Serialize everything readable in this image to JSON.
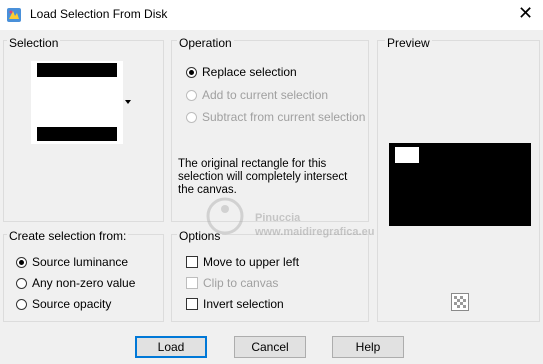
{
  "window": {
    "title": "Load Selection From Disk"
  },
  "selection": {
    "label": "Selection"
  },
  "operation": {
    "label": "Operation",
    "options": [
      {
        "label": "Replace selection",
        "checked": true,
        "enabled": true
      },
      {
        "label": "Add to current selection",
        "checked": false,
        "enabled": false
      },
      {
        "label": "Subtract from current selection",
        "checked": false,
        "enabled": false
      }
    ],
    "description": "The original rectangle for this selection will completely intersect the canvas."
  },
  "preview": {
    "label": "Preview"
  },
  "create_from": {
    "label": "Create selection from:",
    "options": [
      {
        "label": "Source luminance",
        "checked": true
      },
      {
        "label": "Any non-zero value",
        "checked": false
      },
      {
        "label": "Source opacity",
        "checked": false
      }
    ]
  },
  "options": {
    "label": "Options",
    "items": [
      {
        "label": "Move to upper left",
        "checked": false,
        "enabled": true
      },
      {
        "label": "Clip to canvas",
        "checked": false,
        "enabled": false
      },
      {
        "label": "Invert selection",
        "checked": false,
        "enabled": true
      }
    ]
  },
  "buttons": {
    "load": "Load",
    "cancel": "Cancel",
    "help": "Help"
  },
  "watermark": {
    "name": "Pinuccia",
    "url": "www.maidiregrafica.eu"
  }
}
